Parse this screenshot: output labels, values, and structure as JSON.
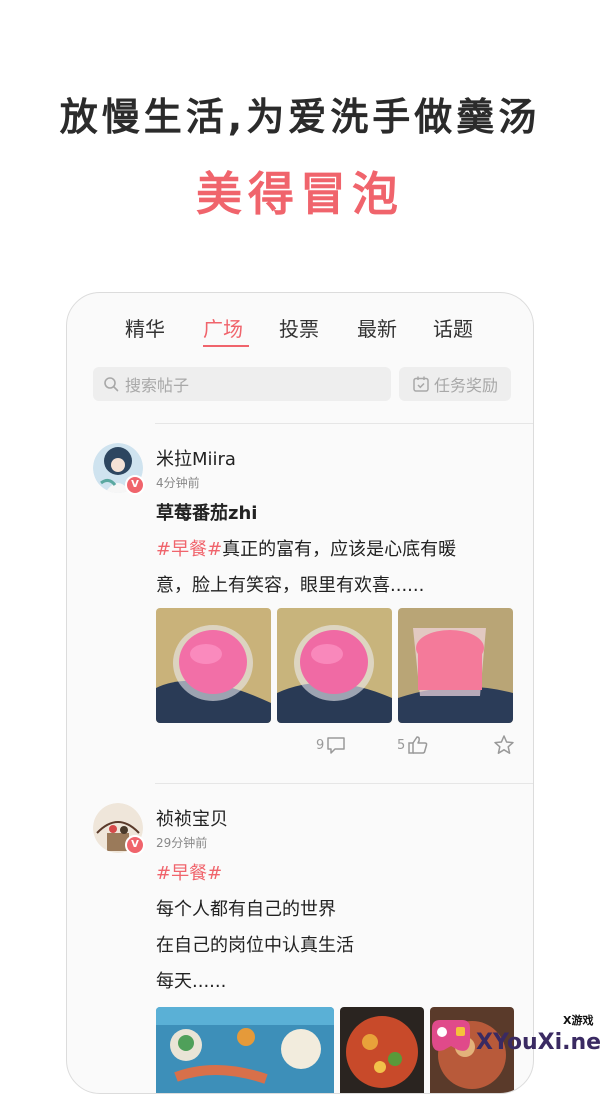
{
  "promo": {
    "headline": "放慢生活,为爱洗手做羹汤",
    "subheadline": "美得冒泡"
  },
  "tabs": [
    {
      "label": "精华",
      "active": false
    },
    {
      "label": "广场",
      "active": true
    },
    {
      "label": "投票",
      "active": false
    },
    {
      "label": "最新",
      "active": false
    },
    {
      "label": "话题",
      "active": false
    }
  ],
  "search": {
    "placeholder": "搜索帖子",
    "icon": "search-icon"
  },
  "task_button": {
    "label": "任务奖励",
    "icon": "calendar-icon"
  },
  "posts": [
    {
      "username": "米拉Miira",
      "time": "4分钟前",
      "title": "草莓番茄zhi",
      "hashtag": "#早餐#",
      "lines": [
        "真正的富有，应该是心底有暖",
        "意，脸上有笑容，眼里有欢喜......"
      ],
      "comments": "9",
      "likes": "5"
    },
    {
      "username": "祯祯宝贝",
      "time": "29分钟前",
      "hashtag": "#早餐#",
      "lines": [
        "每个人都有自己的世界",
        "在自己的岗位中认真生活",
        "每天......"
      ]
    }
  ],
  "watermark": {
    "small": "X游戏",
    "big": "XYouXi.net"
  },
  "colors": {
    "accent": "#f0646c",
    "text": "#222222",
    "muted": "#a8a8a8"
  }
}
